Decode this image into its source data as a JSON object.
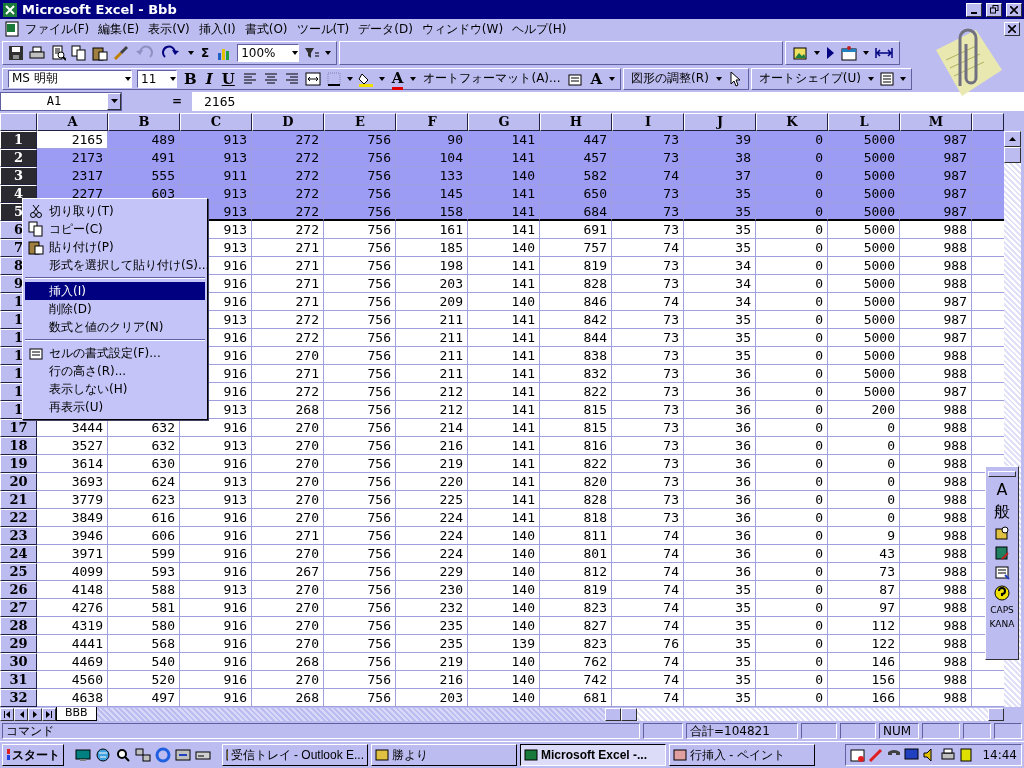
{
  "window": {
    "title": "Microsoft Excel - Bbb"
  },
  "menu_bar": [
    "ファイル(F)",
    "編集(E)",
    "表示(V)",
    "挿入(I)",
    "書式(O)",
    "ツール(T)",
    "データ(D)",
    "ウィンドウ(W)",
    "ヘルプ(H)"
  ],
  "toolbar_standard": {
    "undo": {
      "disabled": true
    },
    "redo": {
      "disabled": false
    },
    "sum": "Σ",
    "zoom": "100%"
  },
  "toolbar_formatting": {
    "font": "MS 明朝",
    "size": "11",
    "bold": "B",
    "italic": "I",
    "underline": "U",
    "font_color": "A",
    "autoformat": "オートフォーマット(A)...",
    "grow_font": "A",
    "adjust": "図形の調整(R)",
    "autoshape": "オートシェイプ(U)"
  },
  "formula_bar": {
    "name_box": "A1",
    "equals": "=",
    "value": "2165"
  },
  "sheet": {
    "columns": [
      "A",
      "B",
      "C",
      "D",
      "E",
      "F",
      "G",
      "H",
      "I",
      "J",
      "K",
      "L",
      "M"
    ],
    "rows": [
      {
        "header": "1",
        "selected": true,
        "cells": [
          {
            "value": "2165",
            "active": true
          },
          "489",
          "913",
          "272",
          "756",
          "90",
          "141",
          "447",
          "73",
          "39",
          "0",
          "5000",
          "987"
        ]
      },
      {
        "header": "2",
        "selected": true,
        "cells": [
          "2173",
          "491",
          "913",
          "272",
          "756",
          "104",
          "141",
          "457",
          "73",
          "38",
          "0",
          "5000",
          "987"
        ]
      },
      {
        "header": "3",
        "selected": true,
        "cells": [
          "2317",
          "555",
          "911",
          "272",
          "756",
          "133",
          "140",
          "582",
          "74",
          "37",
          "0",
          "5000",
          "987"
        ]
      },
      {
        "header": "4",
        "selected": true,
        "cells": [
          "2277",
          "603",
          "913",
          "272",
          "756",
          "145",
          "141",
          "650",
          "73",
          "35",
          "0",
          "5000",
          "987"
        ]
      },
      {
        "header": "5",
        "selected": true,
        "cells": [
          null,
          null,
          "913",
          "272",
          "756",
          "158",
          "141",
          "684",
          "73",
          "35",
          "0",
          "5000",
          "987"
        ]
      },
      {
        "header": "6",
        "selected": false,
        "cells": [
          null,
          null,
          "913",
          "272",
          "756",
          "161",
          "141",
          "691",
          "73",
          "35",
          "0",
          "5000",
          "988"
        ]
      },
      {
        "header": "7",
        "selected": false,
        "cells": [
          null,
          null,
          "913",
          "271",
          "756",
          "185",
          "140",
          "757",
          "74",
          "35",
          "0",
          "5000",
          "988"
        ]
      },
      {
        "header": "8",
        "selected": false,
        "cells": [
          null,
          null,
          "916",
          "271",
          "756",
          "198",
          "141",
          "819",
          "73",
          "34",
          "0",
          "5000",
          "988"
        ]
      },
      {
        "header": "9",
        "selected": false,
        "cells": [
          null,
          null,
          "916",
          "271",
          "756",
          "203",
          "141",
          "828",
          "73",
          "34",
          "0",
          "5000",
          "988"
        ]
      },
      {
        "header": "1",
        "selected": false,
        "cells": [
          null,
          null,
          "916",
          "271",
          "756",
          "209",
          "140",
          "846",
          "74",
          "34",
          "0",
          "5000",
          "987"
        ]
      },
      {
        "header": "1",
        "selected": false,
        "cells": [
          null,
          null,
          "913",
          "272",
          "756",
          "211",
          "141",
          "842",
          "73",
          "35",
          "0",
          "5000",
          "987"
        ]
      },
      {
        "header": "1",
        "selected": false,
        "cells": [
          null,
          null,
          "916",
          "272",
          "756",
          "211",
          "141",
          "844",
          "73",
          "35",
          "0",
          "5000",
          "987"
        ]
      },
      {
        "header": "1",
        "selected": false,
        "cells": [
          null,
          null,
          "916",
          "270",
          "756",
          "211",
          "141",
          "838",
          "73",
          "35",
          "0",
          "5000",
          "988"
        ]
      },
      {
        "header": "1",
        "selected": false,
        "cells": [
          null,
          null,
          "916",
          "271",
          "756",
          "211",
          "141",
          "832",
          "73",
          "36",
          "0",
          "5000",
          "988"
        ]
      },
      {
        "header": "1",
        "selected": false,
        "cells": [
          null,
          null,
          "916",
          "272",
          "756",
          "212",
          "141",
          "822",
          "73",
          "36",
          "0",
          "5000",
          "987"
        ]
      },
      {
        "header": "1",
        "selected": false,
        "cells": [
          null,
          null,
          "913",
          "268",
          "756",
          "212",
          "141",
          "815",
          "73",
          "36",
          "0",
          "200",
          "988"
        ]
      },
      {
        "header": "17",
        "selected": false,
        "cells": [
          "3444",
          "632",
          "916",
          "270",
          "756",
          "214",
          "141",
          "815",
          "73",
          "36",
          "0",
          "0",
          "988"
        ]
      },
      {
        "header": "18",
        "selected": false,
        "cells": [
          "3527",
          "632",
          "913",
          "270",
          "756",
          "216",
          "141",
          "816",
          "73",
          "36",
          "0",
          "0",
          "988"
        ]
      },
      {
        "header": "19",
        "selected": false,
        "cells": [
          "3614",
          "630",
          "916",
          "270",
          "756",
          "219",
          "141",
          "822",
          "73",
          "36",
          "0",
          "0",
          "988"
        ]
      },
      {
        "header": "20",
        "selected": false,
        "cells": [
          "3693",
          "624",
          "913",
          "270",
          "756",
          "220",
          "141",
          "820",
          "73",
          "36",
          "0",
          "0",
          "988"
        ]
      },
      {
        "header": "21",
        "selected": false,
        "cells": [
          "3779",
          "623",
          "913",
          "270",
          "756",
          "225",
          "141",
          "828",
          "73",
          "36",
          "0",
          "0",
          "988"
        ]
      },
      {
        "header": "22",
        "selected": false,
        "cells": [
          "3849",
          "616",
          "916",
          "270",
          "756",
          "224",
          "141",
          "818",
          "73",
          "36",
          "0",
          "0",
          "988"
        ]
      },
      {
        "header": "23",
        "selected": false,
        "cells": [
          "3946",
          "606",
          "916",
          "271",
          "756",
          "224",
          "140",
          "811",
          "74",
          "36",
          "0",
          "9",
          "988"
        ]
      },
      {
        "header": "24",
        "selected": false,
        "cells": [
          "3971",
          "599",
          "916",
          "270",
          "756",
          "224",
          "140",
          "801",
          "74",
          "36",
          "0",
          "43",
          "988"
        ]
      },
      {
        "header": "25",
        "selected": false,
        "cells": [
          "4099",
          "593",
          "916",
          "267",
          "756",
          "229",
          "140",
          "812",
          "74",
          "36",
          "0",
          "73",
          "988"
        ]
      },
      {
        "header": "26",
        "selected": false,
        "cells": [
          "4148",
          "588",
          "913",
          "270",
          "756",
          "230",
          "140",
          "819",
          "74",
          "35",
          "0",
          "87",
          "988"
        ]
      },
      {
        "header": "27",
        "selected": false,
        "cells": [
          "4276",
          "581",
          "916",
          "270",
          "756",
          "232",
          "140",
          "823",
          "74",
          "35",
          "0",
          "97",
          "988"
        ]
      },
      {
        "header": "28",
        "selected": false,
        "cells": [
          "4319",
          "580",
          "916",
          "270",
          "756",
          "235",
          "140",
          "827",
          "74",
          "35",
          "0",
          "112",
          "988"
        ]
      },
      {
        "header": "29",
        "selected": false,
        "cells": [
          "4441",
          "568",
          "916",
          "270",
          "756",
          "235",
          "139",
          "823",
          "76",
          "35",
          "0",
          "122",
          "988"
        ]
      },
      {
        "header": "30",
        "selected": false,
        "cells": [
          "4469",
          "540",
          "916",
          "268",
          "756",
          "219",
          "140",
          "762",
          "74",
          "35",
          "0",
          "146",
          "988"
        ]
      },
      {
        "header": "31",
        "selected": false,
        "cells": [
          "4560",
          "520",
          "916",
          "270",
          "756",
          "216",
          "140",
          "742",
          "74",
          "35",
          "0",
          "156",
          "988"
        ]
      },
      {
        "header": "32",
        "selected": false,
        "cells": [
          "4638",
          "497",
          "916",
          "268",
          "756",
          "203",
          "140",
          "681",
          "74",
          "35",
          "0",
          "166",
          "988"
        ]
      }
    ]
  },
  "context_menu": [
    {
      "kind": "item",
      "label": "切り取り(T)",
      "selected": false
    },
    {
      "kind": "item",
      "label": "コピー(C)",
      "selected": false
    },
    {
      "kind": "item",
      "label": "貼り付け(P)",
      "selected": false
    },
    {
      "kind": "item",
      "label": "形式を選択して貼り付け(S)...",
      "selected": false
    },
    {
      "kind": "separator"
    },
    {
      "kind": "item",
      "label": "挿入(I)",
      "selected": true
    },
    {
      "kind": "item",
      "label": "削除(D)",
      "selected": false
    },
    {
      "kind": "item",
      "label": "数式と値のクリア(N)",
      "selected": false
    },
    {
      "kind": "separator"
    },
    {
      "kind": "item",
      "label": "セルの書式設定(F)...",
      "selected": false
    },
    {
      "kind": "item",
      "label": "行の高さ(R)...",
      "selected": false
    },
    {
      "kind": "item",
      "label": "表示しない(H)",
      "selected": false
    },
    {
      "kind": "item",
      "label": "再表示(U)",
      "selected": false
    }
  ],
  "sheet_tabs": [
    {
      "label": "BBB",
      "selected": true
    }
  ],
  "ime_toolbar": {
    "mode": "A",
    "conversion": "般",
    "caps": "CAPS",
    "kana": "KANA"
  },
  "status_bar": {
    "mode": "コマンド",
    "sum": "合計=104821",
    "num": "NUM"
  },
  "taskbar": {
    "start": "スタート",
    "tasks": [
      {
        "label": "受信トレイ - Outlook E...",
        "selected": false
      },
      {
        "label": "勝より",
        "selected": false
      },
      {
        "label": "Microsoft Excel -...",
        "selected": true
      },
      {
        "label": "行挿入 - ペイント",
        "selected": false
      }
    ],
    "clock": "14:44"
  }
}
